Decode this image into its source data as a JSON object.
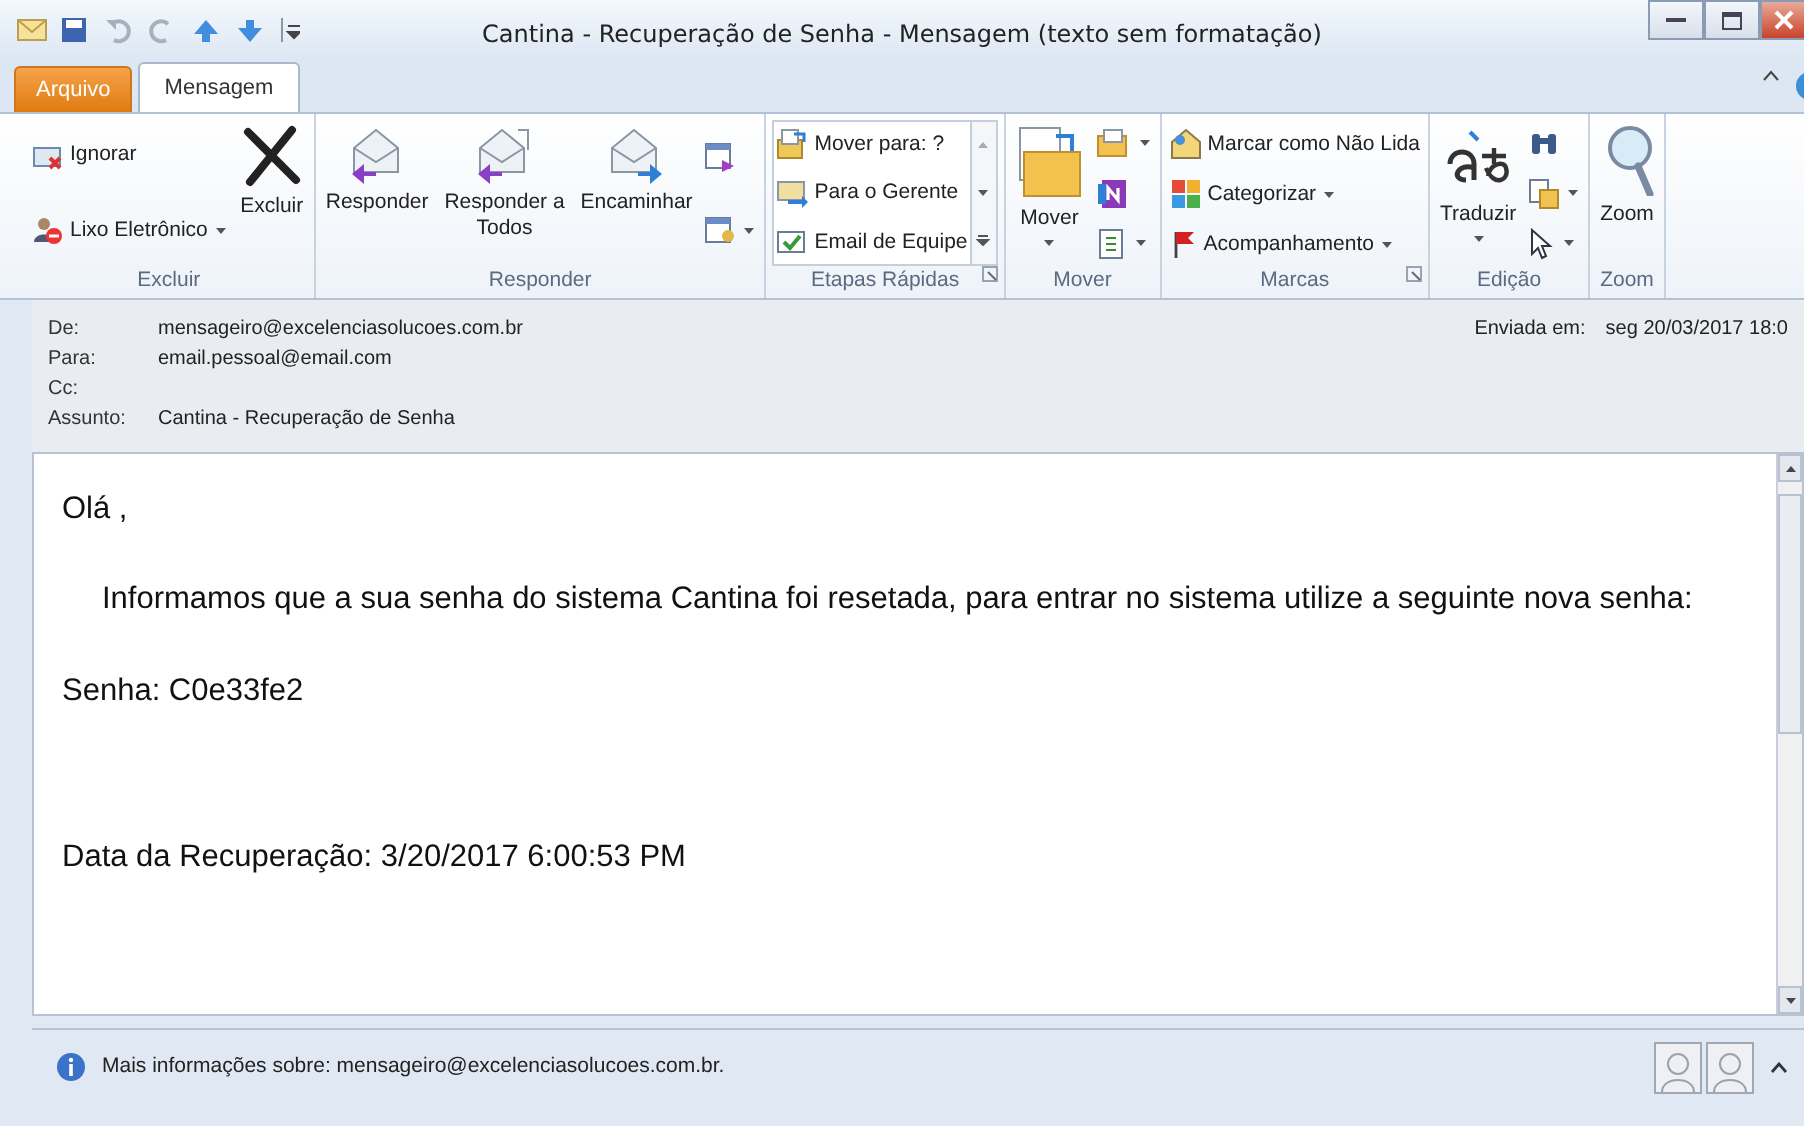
{
  "window": {
    "title": "Cantina - Recuperação de Senha  -  Mensagem (texto sem formatação)"
  },
  "tabs": [
    {
      "label": "Arquivo",
      "kind": "backstage",
      "selected": false
    },
    {
      "label": "Mensagem",
      "kind": "normal",
      "selected": true
    }
  ],
  "ribbon": {
    "groups": [
      {
        "label": "Excluir",
        "launcher": false,
        "gallery": false,
        "columns": [
          [
            {
              "kind": "small",
              "label": "Ignorar",
              "dropdown": false
            },
            {
              "kind": "small",
              "label": "Lixo Eletrônico",
              "dropdown": true
            }
          ],
          [
            {
              "kind": "large",
              "label": "Excluir",
              "dropdown": false
            }
          ]
        ]
      },
      {
        "label": "Responder",
        "launcher": false,
        "gallery": false,
        "columns": [
          [
            {
              "kind": "large",
              "label": "Responder",
              "dropdown": false
            }
          ],
          [
            {
              "kind": "large",
              "label": "Responder a Todos",
              "dropdown": false
            }
          ],
          [
            {
              "kind": "large",
              "label": "Encaminhar",
              "dropdown": false
            }
          ],
          [
            {
              "kind": "icon",
              "dropdown": false
            },
            {
              "kind": "icon",
              "dropdown": true
            }
          ]
        ]
      },
      {
        "label": "Etapas Rápidas",
        "launcher": true,
        "gallery": true,
        "columns": [
          [
            {
              "kind": "small",
              "label": "Mover para: ?",
              "dropdown": false
            },
            {
              "kind": "small",
              "label": "Para o Gerente",
              "dropdown": false
            },
            {
              "kind": "small",
              "label": "Email de Equipe",
              "dropdown": false
            }
          ]
        ]
      },
      {
        "label": "Mover",
        "launcher": false,
        "gallery": false,
        "columns": [
          [
            {
              "kind": "large",
              "label": "Mover",
              "dropdown": true
            }
          ],
          [
            {
              "kind": "icon",
              "dropdown": true
            },
            {
              "kind": "icon",
              "dropdown": false
            },
            {
              "kind": "icon",
              "dropdown": true
            }
          ]
        ]
      },
      {
        "label": "Marcas",
        "launcher": true,
        "gallery": false,
        "columns": [
          [
            {
              "kind": "small",
              "label": "Marcar como Não Lida",
              "dropdown": false
            },
            {
              "kind": "small",
              "label": "Categorizar",
              "dropdown": true
            },
            {
              "kind": "small",
              "label": "Acompanhamento",
              "dropdown": true
            }
          ]
        ]
      },
      {
        "label": "Edição",
        "launcher": false,
        "gallery": false,
        "columns": [
          [
            {
              "kind": "large",
              "label": "Traduzir",
              "dropdown": true
            }
          ],
          [
            {
              "kind": "icon",
              "dropdown": false
            },
            {
              "kind": "icon",
              "dropdown": true
            },
            {
              "kind": "icon",
              "dropdown": true
            }
          ]
        ]
      },
      {
        "label": "Zoom",
        "launcher": false,
        "gallery": false,
        "columns": [
          [
            {
              "kind": "large",
              "label": "Zoom",
              "dropdown": false
            }
          ]
        ]
      }
    ]
  },
  "header": {
    "fields": [
      {
        "label": "De:",
        "value": "mensageiro@excelenciasolucoes.com.br"
      },
      {
        "label": "Para:",
        "value": "email.pessoal@email.com"
      },
      {
        "label": "Cc:"
      },
      {
        "label": "Assunto:",
        "value": "Cantina - Recuperação de Senha"
      }
    ],
    "sent": {
      "label": "Enviada em:",
      "value": "seg 20/03/2017 18:0"
    }
  },
  "body": {
    "paragraphs": [
      {
        "kind": "plain",
        "text": "Olá ,"
      },
      {
        "kind": "indented",
        "text": "Informamos que a sua senha do sistema Cantina foi resetada, para entrar no sistema utilize a seguinte nova senha:"
      },
      {
        "kind": "plain",
        "text": "Senha: C0e33fe2"
      },
      {
        "kind": "spaced",
        "text": "Data da Recuperação: 3/20/2017 6:00:53 PM"
      }
    ]
  },
  "info_bar": {
    "text": "Mais informações sobre: mensageiro@excelenciasolucoes.com.br."
  }
}
